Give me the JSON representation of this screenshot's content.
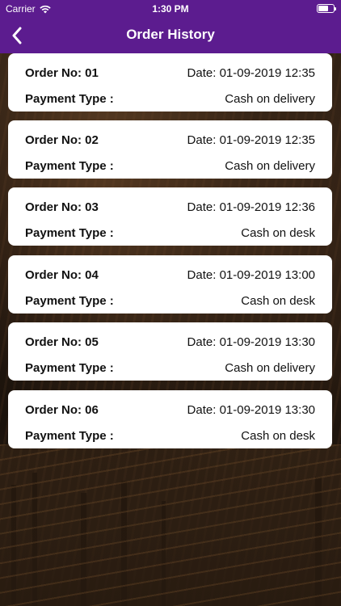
{
  "status_bar": {
    "carrier": "Carrier",
    "time": "1:30 PM"
  },
  "nav": {
    "title": "Order History",
    "back_icon": "chevron-left-icon"
  },
  "colors": {
    "brand": "#5c1c8f",
    "card": "#ffffff",
    "text": "#111111"
  },
  "orders": [
    {
      "order_no": "Order No: 01",
      "date": "Date: 01-09-2019 12:35",
      "payment_label": "Payment Type :",
      "payment_type": "Cash on delivery"
    },
    {
      "order_no": "Order No: 02",
      "date": "Date: 01-09-2019 12:35",
      "payment_label": "Payment Type :",
      "payment_type": "Cash on delivery"
    },
    {
      "order_no": "Order No: 03",
      "date": "Date: 01-09-2019 12:36",
      "payment_label": "Payment Type :",
      "payment_type": "Cash on desk"
    },
    {
      "order_no": "Order No: 04",
      "date": "Date: 01-09-2019 13:00",
      "payment_label": "Payment Type :",
      "payment_type": "Cash on desk"
    },
    {
      "order_no": "Order No: 05",
      "date": "Date: 01-09-2019 13:30",
      "payment_label": "Payment Type :",
      "payment_type": "Cash on delivery"
    },
    {
      "order_no": "Order No: 06",
      "date": "Date: 01-09-2019 13:30",
      "payment_label": "Payment Type :",
      "payment_type": "Cash on desk"
    }
  ]
}
